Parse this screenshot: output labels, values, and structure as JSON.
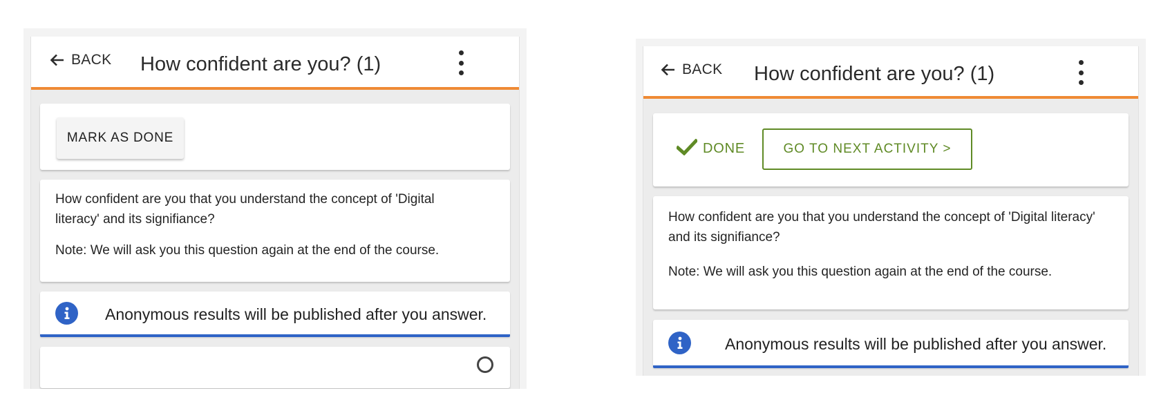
{
  "left_view": {
    "header": {
      "back_label": "BACK",
      "title": "How confident are you? (1)"
    },
    "completion": {
      "mark_done_label": "MARK AS DONE"
    },
    "question": {
      "text": "How confident are you that you understand the concept of 'Digital literacy' and its signifiance?",
      "note": "Note: We will ask you this question again at the end of the course."
    },
    "info_banner": {
      "text": "Anonymous results will be published after you answer."
    }
  },
  "right_view": {
    "header": {
      "back_label": "BACK",
      "title": "How confident are you? (1)"
    },
    "completion": {
      "done_label": "DONE",
      "next_activity_label": "GO TO NEXT ACTIVITY >"
    },
    "question": {
      "text": "How confident are you that you understand the concept of 'Digital literacy' and its signifiance?",
      "note": "Note: We will ask you this question again at the end of the course."
    },
    "info_banner": {
      "text": "Anonymous results will be published after you answer."
    }
  },
  "colors": {
    "header_accent": "#ef8a34",
    "done_green": "#5f8a25",
    "info_blue": "#2f63c6"
  },
  "icons": {
    "back": "arrow-left-icon",
    "menu": "more-vertical-icon",
    "done": "checkmark-icon",
    "info": "info-circle-icon"
  }
}
